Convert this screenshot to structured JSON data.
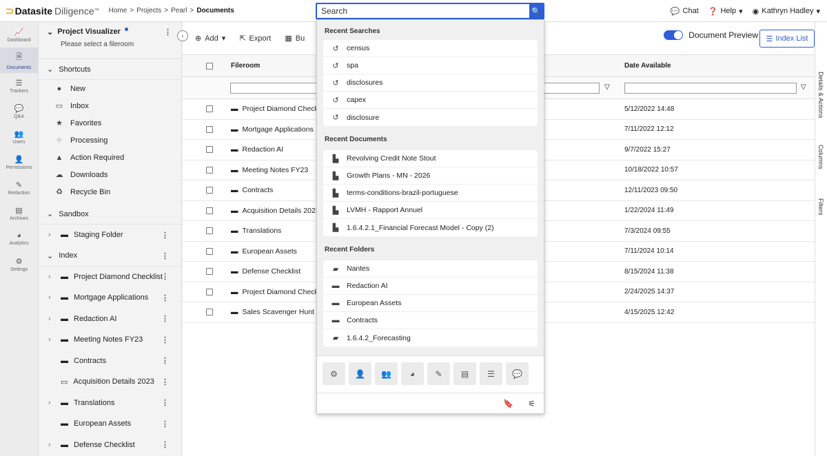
{
  "header": {
    "brand_bold": "Datasite",
    "brand_regular": "Diligence",
    "trademark": "™",
    "breadcrumbs": [
      "Home",
      "Projects",
      "Pearl",
      "Documents"
    ],
    "separator": ">",
    "search_value": "Search",
    "chat_label": "Chat",
    "help_label": "Help",
    "user_name": "Kathryn Hadley"
  },
  "rail": [
    {
      "label": "Dashboard",
      "icon": "dashboard-icon"
    },
    {
      "label": "Documents",
      "icon": "documents-icon"
    },
    {
      "label": "Trackers",
      "icon": "trackers-icon"
    },
    {
      "label": "Q&A",
      "icon": "qa-icon"
    },
    {
      "label": "Users",
      "icon": "users-icon"
    },
    {
      "label": "Permissions",
      "icon": "permissions-icon"
    },
    {
      "label": "Redaction",
      "icon": "redaction-icon"
    },
    {
      "label": "Archives",
      "icon": "archives-icon"
    },
    {
      "label": "Analytics",
      "icon": "analytics-icon"
    },
    {
      "label": "Settings",
      "icon": "settings-icon"
    }
  ],
  "tree": {
    "project_visualizer": "Project Visualizer",
    "select_fileroom": "Please select a fileroom",
    "shortcuts_label": "Shortcuts",
    "shortcuts": [
      "New",
      "Inbox",
      "Favorites",
      "Processing",
      "Action Required",
      "Downloads",
      "Recycle Bin"
    ],
    "sandbox_label": "Sandbox",
    "sandbox_items": [
      "Staging Folder"
    ],
    "index_label": "Index",
    "index_items": [
      "Project Diamond Checklist",
      "Mortgage Applications",
      "Redaction AI",
      "Meeting Notes FY23",
      "Contracts",
      "Acquisition Details 2023",
      "Translations",
      "European Assets",
      "Defense Checklist"
    ]
  },
  "toolbar": {
    "add_label": "Add",
    "export_label": "Export",
    "bu_label": "Bu",
    "document_preview_label": "Document Preview",
    "index_list_label": "Index List"
  },
  "table": {
    "col_fileroom": "Fileroom",
    "col_date": "Date Available",
    "rows": [
      {
        "name": "Project Diamond Checkli",
        "date": "5/12/2022 14:48"
      },
      {
        "name": "Mortgage Applications",
        "date": "7/11/2022 12:12"
      },
      {
        "name": "Redaction AI",
        "date": "9/7/2022 15:27"
      },
      {
        "name": "Meeting Notes FY23",
        "date": "10/18/2022 10:57"
      },
      {
        "name": "Contracts",
        "date": "12/11/2023 09:50"
      },
      {
        "name": "Acquisition Details 2023",
        "date": "1/22/2024 11:49"
      },
      {
        "name": "Translations",
        "date": "7/3/2024 09:55"
      },
      {
        "name": "European Assets",
        "date": "7/11/2024 10:14"
      },
      {
        "name": "Defense Checklist",
        "date": "8/15/2024 11:38"
      },
      {
        "name": "Project Diamond Checkli",
        "date": "2/24/2025 14:37"
      },
      {
        "name": "Sales Scavenger Hunt",
        "date": "4/15/2025 12:42"
      }
    ]
  },
  "right_side": {
    "details_actions": "Details & Actions",
    "columns": "Columns",
    "filters": "Filters"
  },
  "dropdown": {
    "recent_searches_label": "Recent Searches",
    "recent_searches": [
      "census",
      "spa",
      "disclosures",
      "capex",
      "disclosure"
    ],
    "recent_documents_label": "Recent Documents",
    "recent_documents": [
      {
        "name": "Revolving Credit Note Stout",
        "type": "word"
      },
      {
        "name": "Growth Plans - MN - 2026",
        "type": "pdf"
      },
      {
        "name": "terms-conditions-brazil-portuguese",
        "type": "pdf"
      },
      {
        "name": "LVMH - Rapport Annuel",
        "type": "pdf"
      },
      {
        "name": "1.6.4.2.1_Financial Forecast Model - Copy (2)",
        "type": "pdf"
      }
    ],
    "recent_folders_label": "Recent Folders",
    "recent_folders": [
      {
        "name": "Nantes",
        "type": "folder"
      },
      {
        "name": "Redaction AI",
        "type": "fileroom"
      },
      {
        "name": "European Assets",
        "type": "fileroom"
      },
      {
        "name": "Contracts",
        "type": "fileroom"
      },
      {
        "name": "1.6.4.2_Forecasting",
        "type": "folder"
      }
    ]
  }
}
